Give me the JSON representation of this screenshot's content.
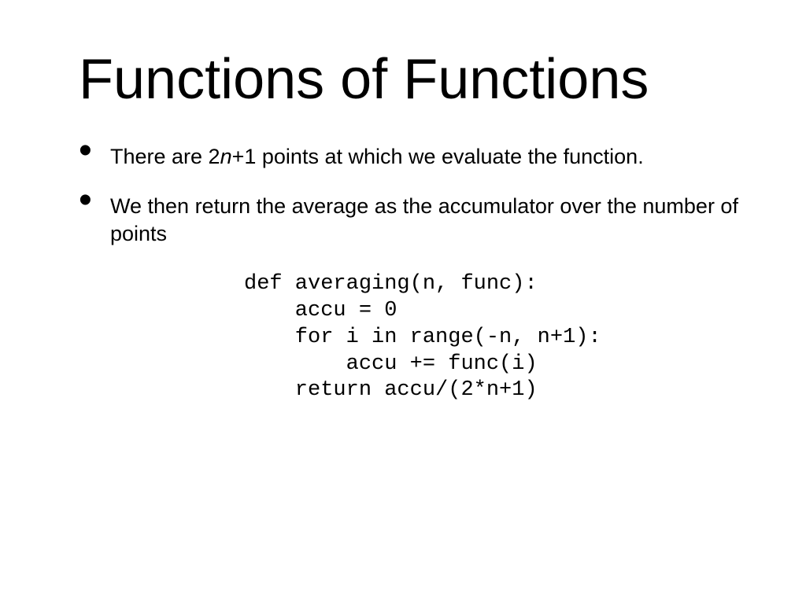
{
  "title": "Functions of Functions",
  "bullets": {
    "b1_pre": "There are 2",
    "b1_mid": "n",
    "b1_post": "+1 points at which we evaluate the function.",
    "b2": "We then return the average as the accumulator over the number of points"
  },
  "code": "def averaging(n, func):\n    accu = 0\n    for i in range(-n, n+1):\n        accu += func(i)\n    return accu/(2*n+1)"
}
